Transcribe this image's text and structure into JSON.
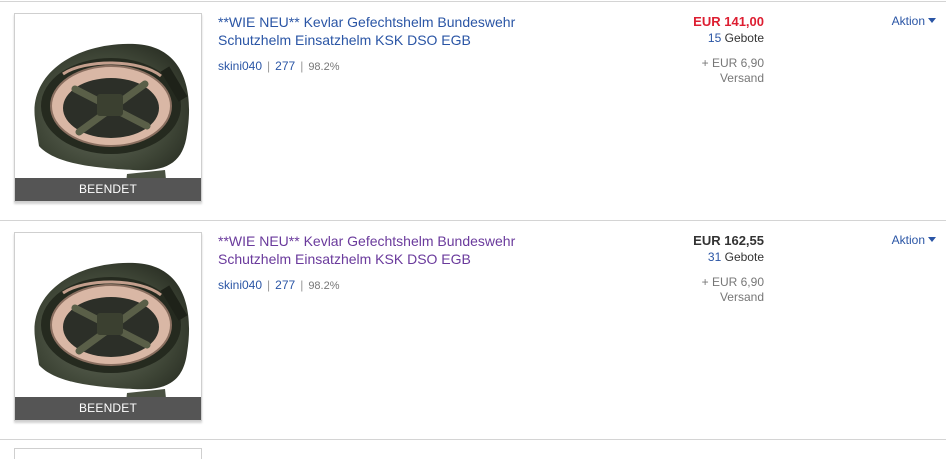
{
  "listings": [
    {
      "title": "**WIE NEU** Kevlar Gefechtshelm Bundeswehr Schutzhelm Einsatzhelm KSK DSO EGB",
      "ended_label": "BEENDET",
      "seller_name": "skini040",
      "seller_score": "277",
      "seller_feedback": "98.2%",
      "price": "EUR 141,00",
      "bid_count": "15",
      "bid_label": "Gebote",
      "shipping_cost": "+ EUR 6,90",
      "shipping_label": "Versand",
      "action_label": "Aktion",
      "price_color": "#dd1e31",
      "title_color": "#2a55a5",
      "image_icon": "helmet-icon"
    },
    {
      "title": "**WIE NEU** Kevlar Gefechtshelm Bundeswehr Schutzhelm Einsatzhelm KSK DSO EGB",
      "ended_label": "BEENDET",
      "seller_name": "skini040",
      "seller_score": "277",
      "seller_feedback": "98.2%",
      "price": "EUR 162,55",
      "bid_count": "31",
      "bid_label": "Gebote",
      "shipping_cost": "+ EUR 6,90",
      "shipping_label": "Versand",
      "action_label": "Aktion",
      "price_color": "#333333",
      "title_color": "#6a3a9c",
      "image_icon": "helmet-icon"
    }
  ],
  "colors": {
    "link": "#2a55a5",
    "visited_link": "#6a3a9c",
    "price_red": "#dd1e31",
    "ended_bar": "#555555",
    "divider": "#d4d4d4"
  }
}
